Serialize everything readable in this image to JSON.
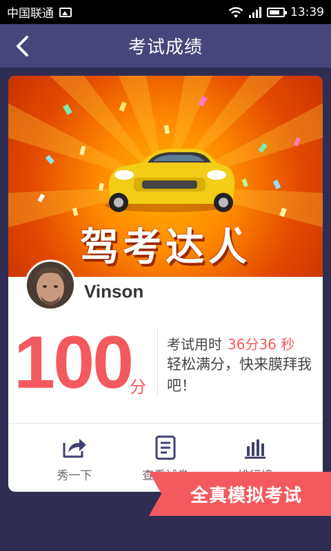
{
  "status_bar": {
    "carrier": "中国联通",
    "time": "13:39"
  },
  "header": {
    "title": "考试成绩"
  },
  "banner": {
    "title": "驾考达人"
  },
  "user": {
    "name": "Vinson"
  },
  "result": {
    "score": "100",
    "score_unit": "分",
    "time_label": "考试用时",
    "time_value": "36分36 秒",
    "praise": "轻松满分，快来膜拜我吧！"
  },
  "actions": [
    {
      "label": "秀一下",
      "icon": "share-icon"
    },
    {
      "label": "查看试卷",
      "icon": "document-icon"
    },
    {
      "label": "排行榜",
      "icon": "bar-chart-icon"
    }
  ],
  "ribbon": {
    "label": "全真模拟考试"
  },
  "colors": {
    "header_bg": "#46467a",
    "page_bg": "#2f2e52",
    "accent_red": "#f25a5f",
    "icon_purple": "#3f3f72"
  }
}
